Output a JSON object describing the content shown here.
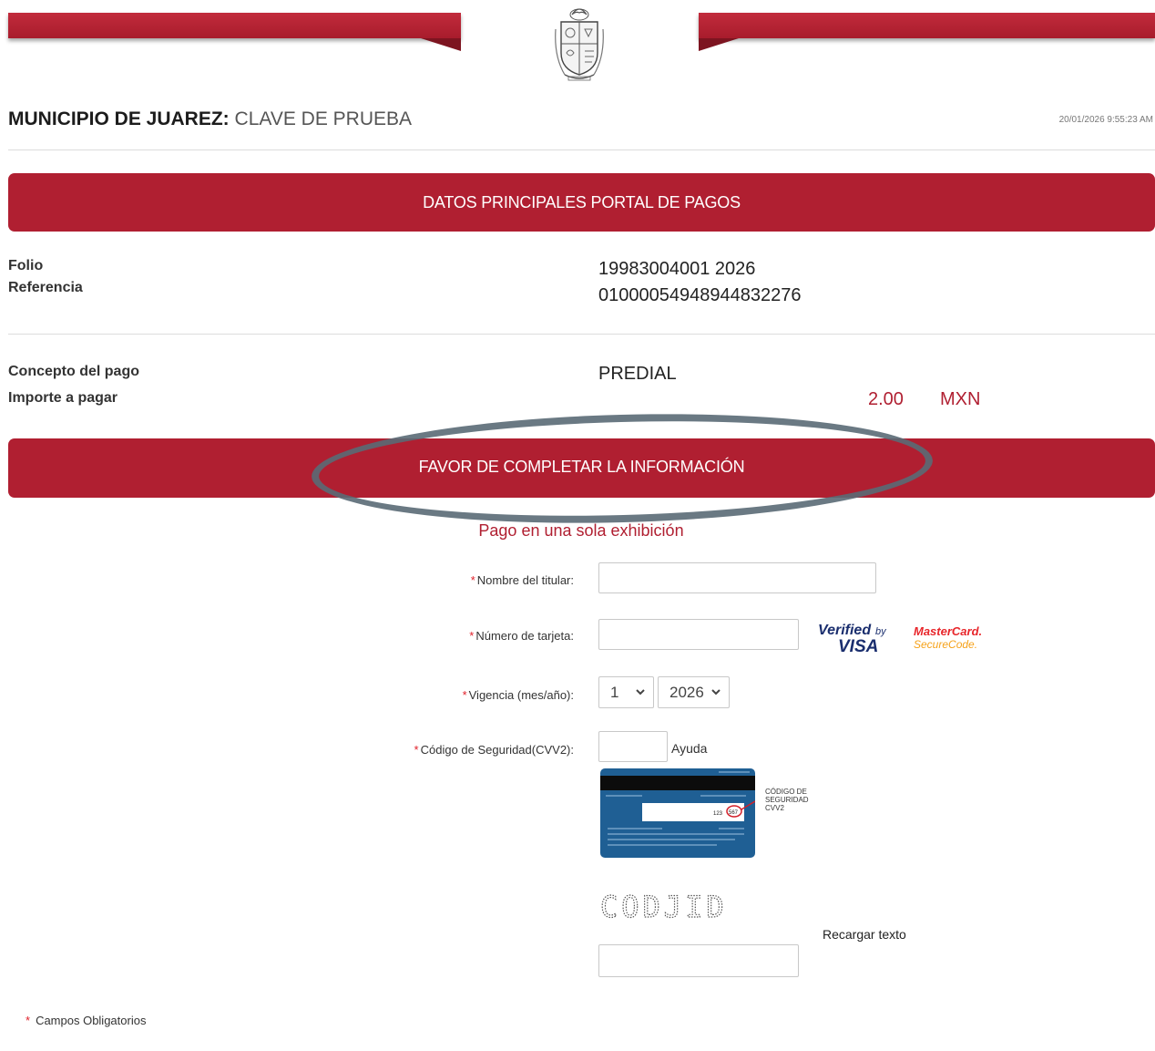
{
  "header": {
    "org_name": "MUNICIPIO DE JUAREZ:",
    "clave": "CLAVE DE PRUEBA",
    "timestamp": "20/01/2026 9:55:23 AM"
  },
  "banner_main": "DATOS PRINCIPALES PORTAL DE PAGOS",
  "details": {
    "folio_label": "Folio",
    "folio_value": "19983004001 2026",
    "referencia_label": "Referencia",
    "referencia_value": "01000054948944832276",
    "concepto_label": "Concepto del pago",
    "concepto_value": "PREDIAL",
    "importe_label": "Importe a pagar",
    "importe_value": "2.00",
    "currency": "MXN"
  },
  "banner_form": "FAVOR DE COMPLETAR LA INFORMACIÓN",
  "form": {
    "subtitle": "Pago en una sola exhibición",
    "required_mark": "*",
    "holder_label": "Nombre del titular:",
    "holder_value": "",
    "card_label": "Número de tarjeta:",
    "card_value": "",
    "expiry_label": "Vigencia (mes/año):",
    "expiry_month": "1",
    "expiry_year": "2026",
    "cvv_label": "Código de Seguridad(CVV2):",
    "cvv_value": "",
    "help_label": "Ayuda",
    "captcha_text": "CODJID",
    "reload_label": "Recargar texto",
    "captcha_value": ""
  },
  "logos": {
    "verified_top": "Verified",
    "verified_by": "by",
    "verified_visa": "VISA",
    "mc_top": "MasterCard.",
    "mc_bottom": "SecureCode."
  },
  "cvv_help": {
    "line1": "CÓDIGO DE",
    "line2": "SEGURIDAD",
    "line3": "CVV2",
    "sample_digits": "123",
    "sample_cvv": "567"
  },
  "footer": {
    "required_note": "Campos Obligatorios"
  },
  "colors": {
    "brand_red": "#b01f31",
    "required_red": "#e0202a",
    "card_blue": "#1f5f94"
  }
}
